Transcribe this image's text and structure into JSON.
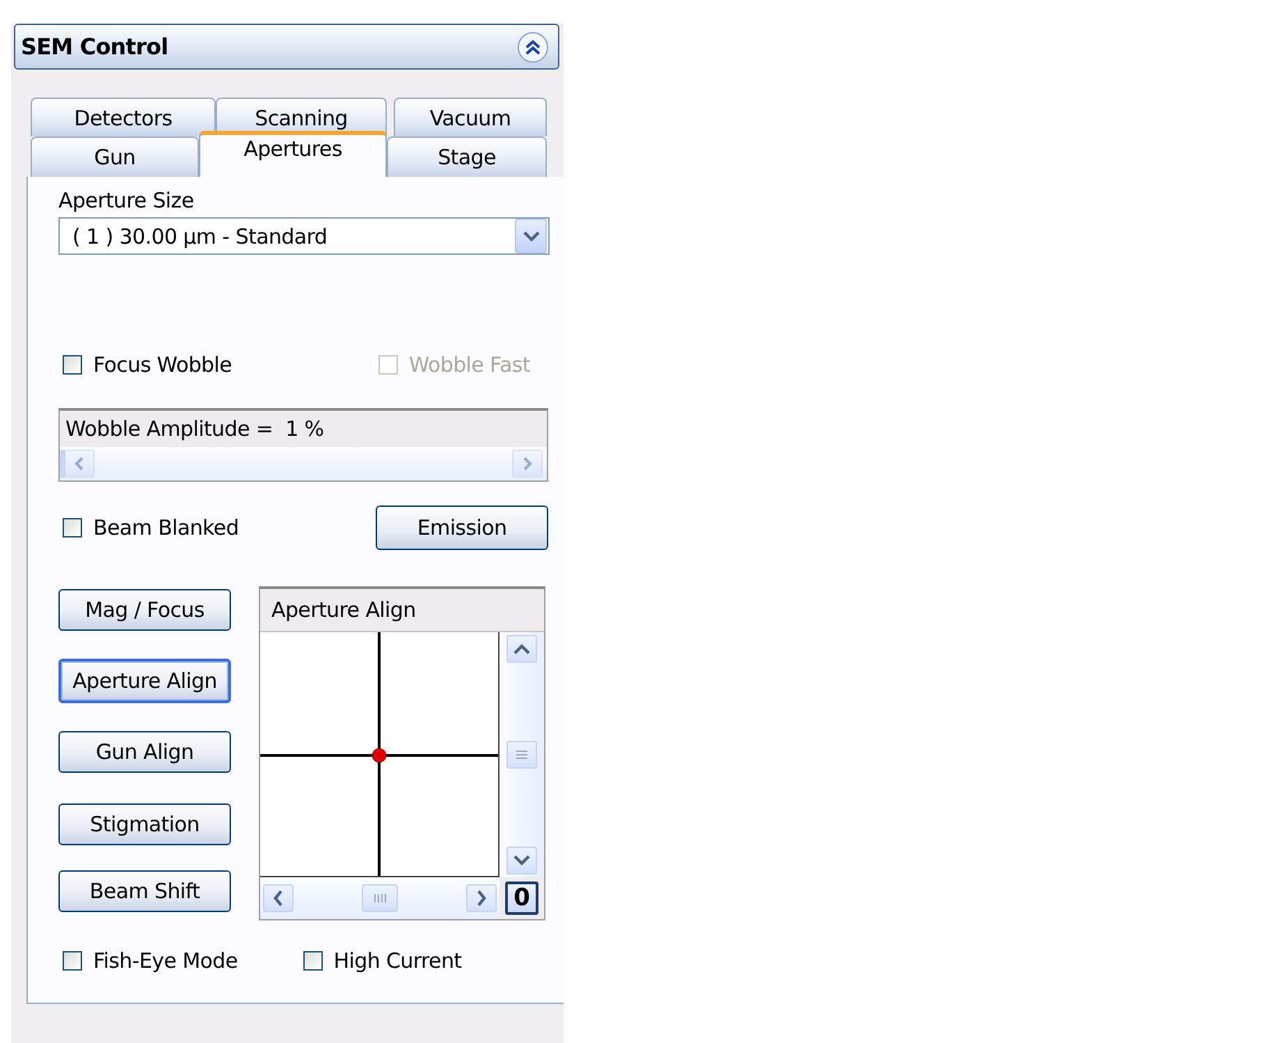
{
  "panel": {
    "title": "SEM Control"
  },
  "tab_rows": [
    [
      {
        "label": "Detectors",
        "selected": false
      },
      {
        "label": "Scanning",
        "selected": false
      },
      {
        "label": "Vacuum",
        "selected": false
      }
    ],
    [
      {
        "label": "Gun",
        "selected": false
      },
      {
        "label": "Apertures",
        "selected": true
      },
      {
        "label": "Stage",
        "selected": false
      }
    ]
  ],
  "aperture_size": {
    "label": "Aperture Size",
    "value": "( 1 ) 30.00 µm - Standard"
  },
  "wobble_checks": [
    {
      "label": "Focus Wobble",
      "checked": false,
      "disabled": false
    },
    {
      "label": "Wobble Fast",
      "checked": false,
      "disabled": true
    }
  ],
  "wobble_amplitude": {
    "label": "Wobble Amplitude =  1 %",
    "level": 0.01
  },
  "beam_blanked": {
    "label": "Beam Blanked",
    "checked": false,
    "disabled": false
  },
  "emission_button": "Emission",
  "mode_buttons": [
    {
      "label": "Mag / Focus",
      "selected": false
    },
    {
      "label": "Aperture Align",
      "selected": true
    },
    {
      "label": "Gun Align",
      "selected": false
    },
    {
      "label": "Stigmation",
      "selected": false
    },
    {
      "label": "Beam Shift",
      "selected": false
    }
  ],
  "align_pad": {
    "title": "Aperture Align",
    "zero_button": "0"
  },
  "bottom_checks": [
    {
      "label": "Fish-Eye Mode",
      "checked": false,
      "disabled": false
    },
    {
      "label": "High Current",
      "checked": false,
      "disabled": false
    }
  ]
}
